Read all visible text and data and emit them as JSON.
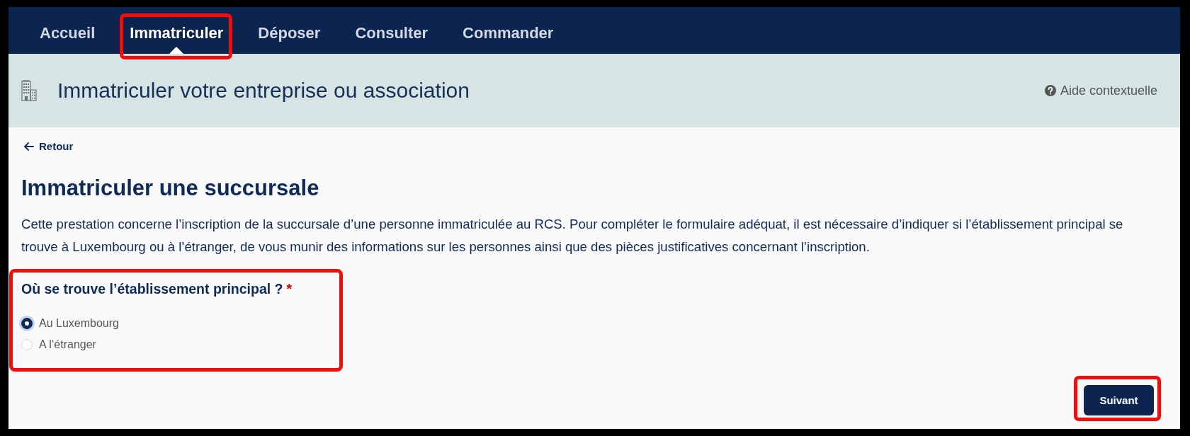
{
  "nav": {
    "items": [
      {
        "label": "Accueil",
        "selected": false,
        "highlighted": false
      },
      {
        "label": "Immatriculer",
        "selected": true,
        "highlighted": true
      },
      {
        "label": "Déposer",
        "selected": false,
        "highlighted": false
      },
      {
        "label": "Consulter",
        "selected": false,
        "highlighted": false
      },
      {
        "label": "Commander",
        "selected": false,
        "highlighted": false
      }
    ]
  },
  "header": {
    "title": "Immatriculer votre entreprise ou association",
    "help_link": "Aide contextuelle"
  },
  "back_link": "Retour",
  "heading": "Immatriculer une succursale",
  "description": "Cette prestation concerne l’inscription de la succursale d’une personne immatriculée au RCS. Pour compléter le formulaire adéquat, il est nécessaire d’indiquer si l’établissement principal se trouve à Luxembourg ou à l’étranger, de vous munir des informations sur les personnes ainsi que des pièces justificatives concernant l’inscription.",
  "question": {
    "label": "Où se trouve l’établissement principal ?",
    "required_marker": "*",
    "highlighted": true,
    "options": [
      {
        "label": "Au Luxembourg",
        "selected": true
      },
      {
        "label": "A l‘étranger",
        "selected": false
      }
    ]
  },
  "next_button": {
    "label": "Suivant",
    "highlighted": true
  }
}
